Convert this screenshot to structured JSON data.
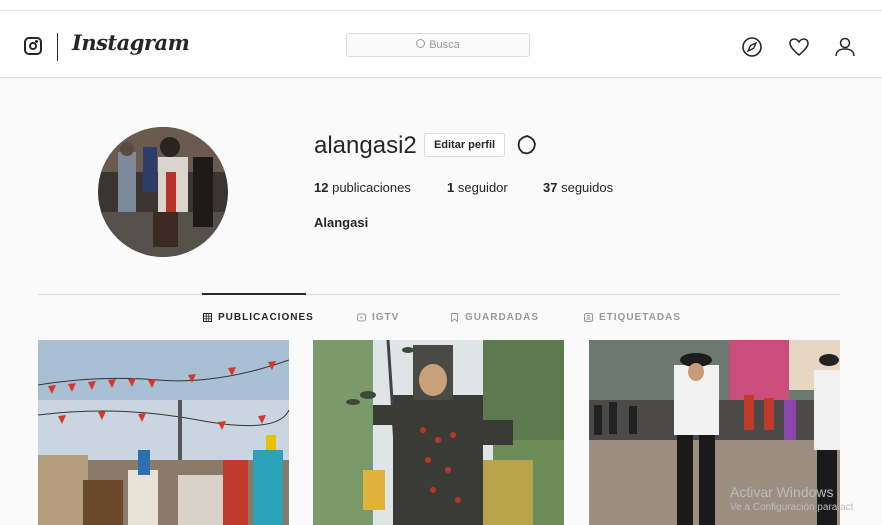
{
  "nav": {
    "logo_text": "Instagram",
    "search_placeholder": "Busca"
  },
  "profile": {
    "username": "alangasi2",
    "edit_button": "Editar perfil",
    "posts_count": "12",
    "posts_label": "publicaciones",
    "followers_count": "1",
    "followers_label": "seguidor",
    "following_count": "37",
    "following_label": "seguidos",
    "full_name": "Alangasi"
  },
  "tabs": [
    {
      "label": "PUBLICACIONES",
      "icon": "grid-icon",
      "active": true
    },
    {
      "label": "IGTV",
      "icon": "igtv-icon",
      "active": false
    },
    {
      "label": "GUARDADAS",
      "icon": "bookmark-icon",
      "active": false
    },
    {
      "label": "ETIQUETADAS",
      "icon": "tagged-icon",
      "active": false
    }
  ],
  "watermark": {
    "line1": "Activar Windows",
    "line2": "Ve a Configuración para act"
  }
}
